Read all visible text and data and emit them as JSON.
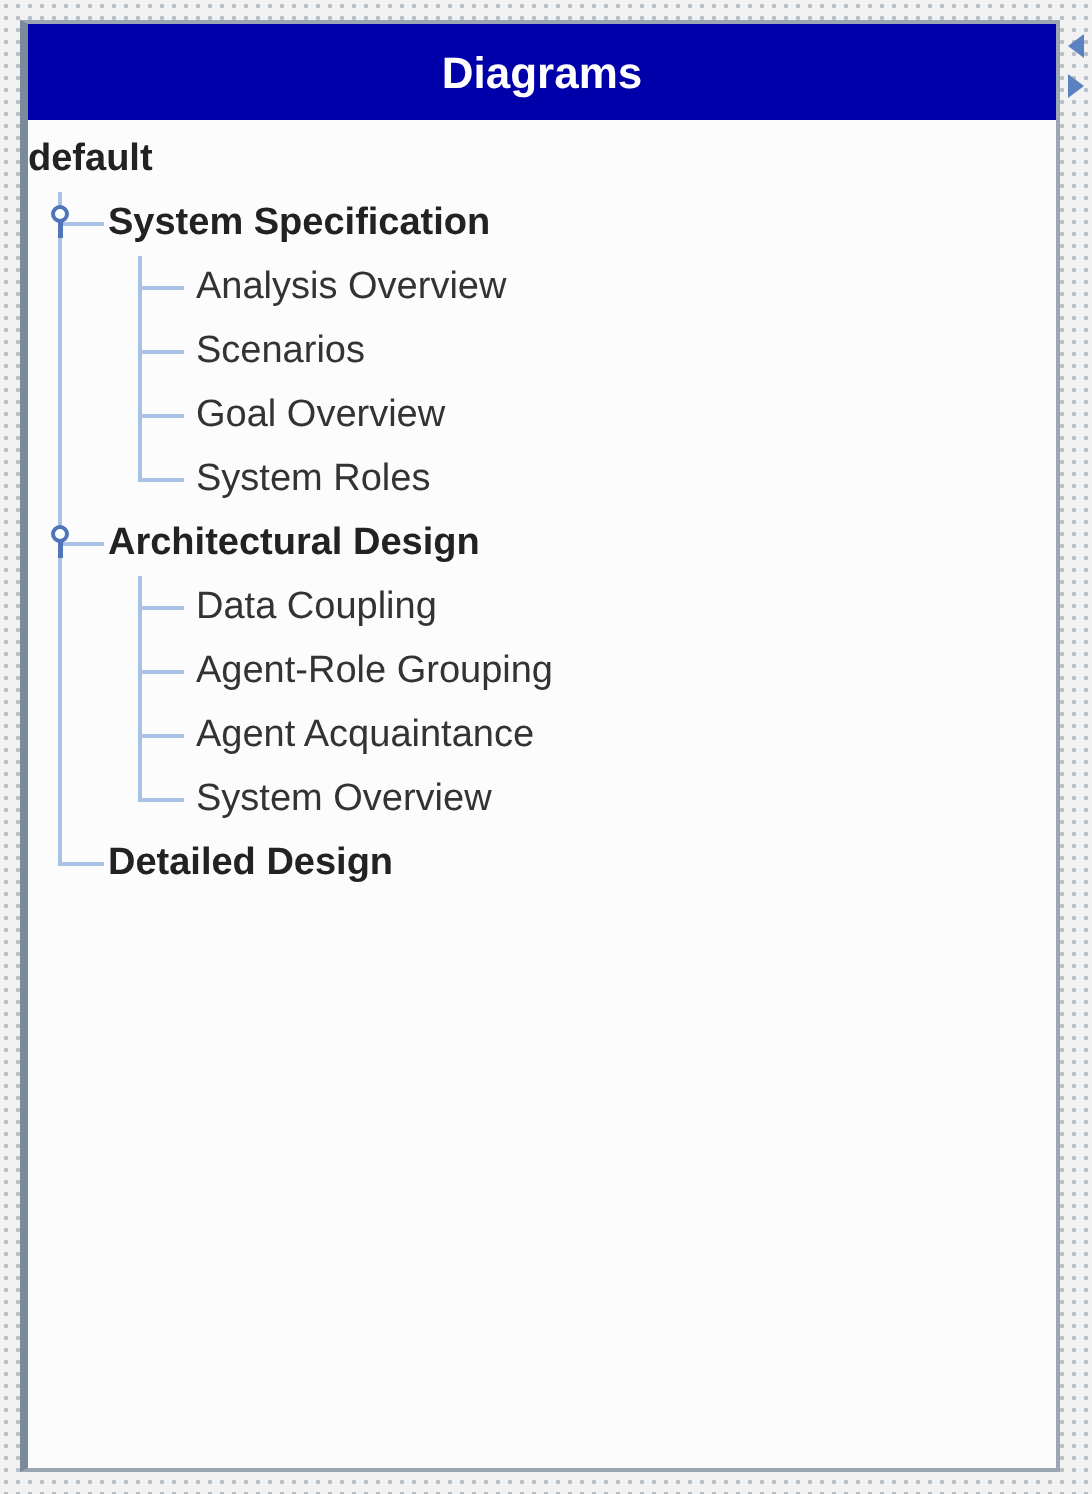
{
  "panel": {
    "title": "Diagrams"
  },
  "tree": {
    "label": "default",
    "kind": "folder",
    "children": [
      {
        "label": "System Specification",
        "kind": "folder",
        "expanded": true,
        "children": [
          {
            "label": "Analysis Overview"
          },
          {
            "label": "Scenarios"
          },
          {
            "label": "Goal Overview"
          },
          {
            "label": "System Roles"
          }
        ]
      },
      {
        "label": "Architectural Design",
        "kind": "folder",
        "expanded": true,
        "children": [
          {
            "label": "Data Coupling"
          },
          {
            "label": "Agent-Role Grouping"
          },
          {
            "label": "Agent Acquaintance"
          },
          {
            "label": "System Overview"
          }
        ]
      },
      {
        "label": "Detailed Design",
        "kind": "folder"
      }
    ]
  }
}
